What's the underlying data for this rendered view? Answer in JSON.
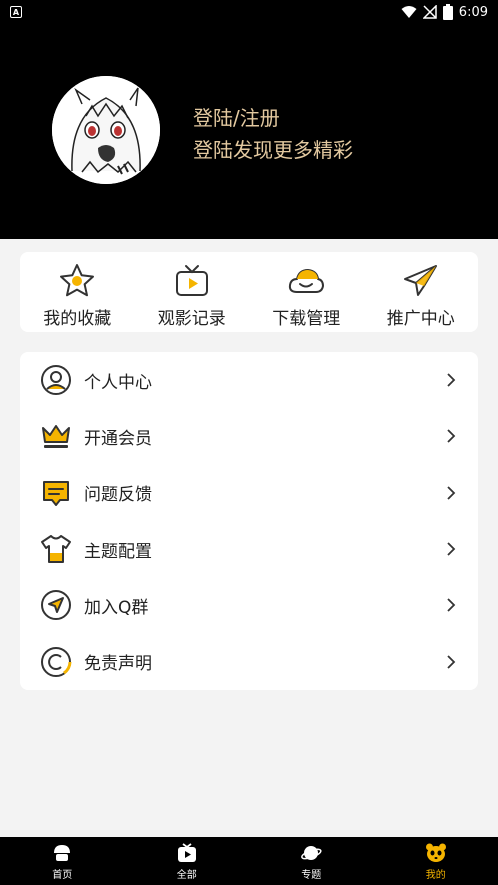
{
  "status": {
    "time": "6:09"
  },
  "profile": {
    "login": "登陆/注册",
    "subtitle": "登陆发现更多精彩"
  },
  "quick": [
    {
      "label": "我的收藏",
      "icon": "star-icon"
    },
    {
      "label": "观影记录",
      "icon": "tv-icon"
    },
    {
      "label": "下载管理",
      "icon": "cloud-icon"
    },
    {
      "label": "推广中心",
      "icon": "paper-plane-icon"
    }
  ],
  "menu": [
    {
      "label": "个人中心",
      "icon": "user-icon"
    },
    {
      "label": "开通会员",
      "icon": "crown-icon"
    },
    {
      "label": "问题反馈",
      "icon": "feedback-icon"
    },
    {
      "label": "主题配置",
      "icon": "tshirt-icon"
    },
    {
      "label": "加入Q群",
      "icon": "location-arrow-icon"
    },
    {
      "label": "免责声明",
      "icon": "copyright-icon"
    }
  ],
  "tabs": [
    {
      "label": "首页",
      "icon": "home-icon"
    },
    {
      "label": "全部",
      "icon": "play-tv-icon"
    },
    {
      "label": "专题",
      "icon": "planet-icon"
    },
    {
      "label": "我的",
      "icon": "panda-icon"
    }
  ],
  "colors": {
    "accent": "#f5b400",
    "gold_text": "#e3c9a0",
    "header_bg": "#000000"
  }
}
